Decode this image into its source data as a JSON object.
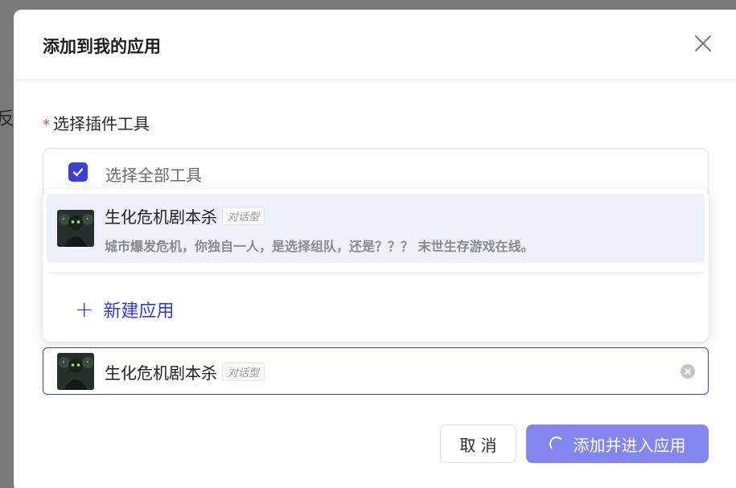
{
  "background": {
    "cut_text": "反"
  },
  "modal": {
    "title": "添加到我的应用",
    "field_label": "选择插件工具",
    "required_mark": "*"
  },
  "select_all": {
    "label": "选择全部工具",
    "checked": true
  },
  "dropdown": {
    "options": [
      {
        "name": "生化危机剧本杀",
        "tag": "对话型",
        "description": "城市爆发危机，你独自一人，是选择组队，还是？？？ 末世生存游戏在线。"
      }
    ],
    "new_app_label": "新建应用"
  },
  "selected": {
    "name": "生化危机剧本杀",
    "tag": "对话型"
  },
  "footer": {
    "cancel_label": "取 消",
    "confirm_label": "添加并进入应用"
  },
  "colors": {
    "accent": "#3b3fd8",
    "primary_btn": "#8286ee",
    "selected_bg": "#eef0fc"
  },
  "icons": [
    "close-icon",
    "check-icon",
    "plus-icon",
    "clear-icon",
    "loading-spinner-icon"
  ]
}
